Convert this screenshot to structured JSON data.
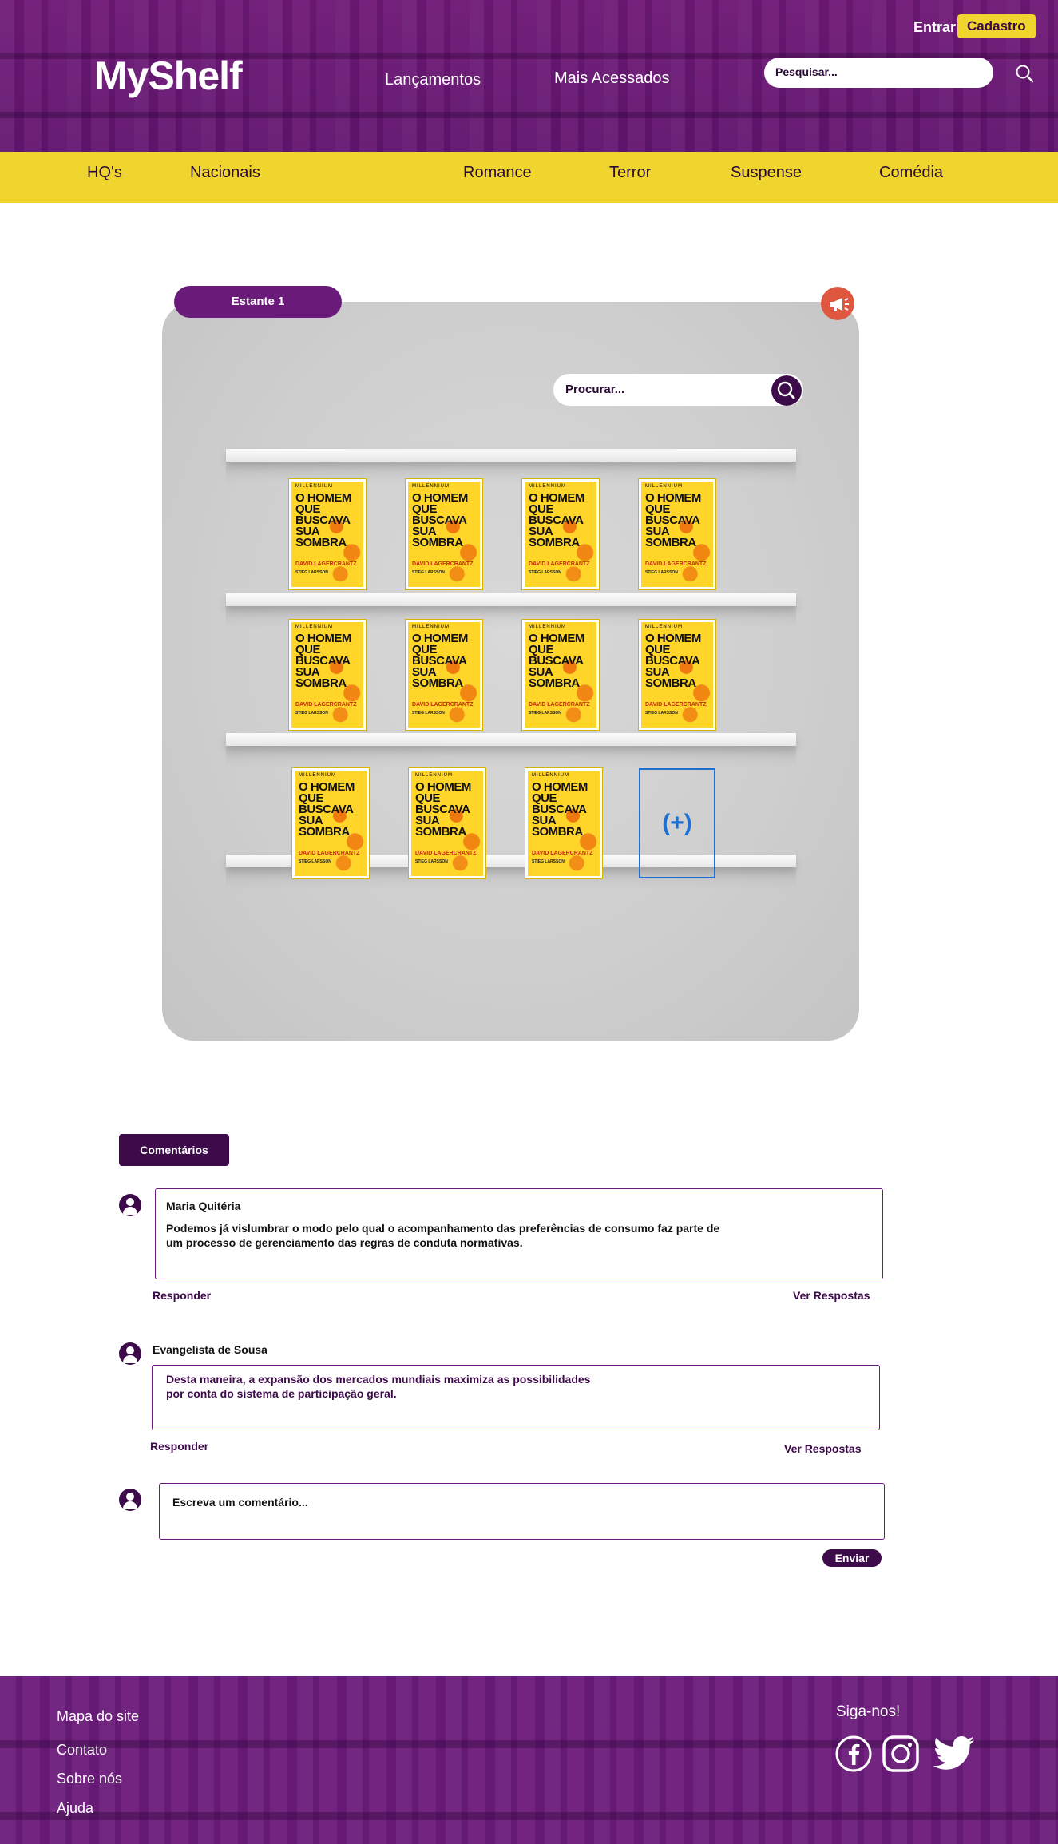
{
  "header": {
    "logo": "MyShelf",
    "nav": [
      "Lançamentos",
      "Mais Acessados"
    ],
    "login_label": "Entrar",
    "signup_label": "Cadastro",
    "search_placeholder": "Pesquisar..."
  },
  "categories": [
    "HQ's",
    "Nacionais",
    "Romance",
    "Terror",
    "Suspense",
    "Comédia"
  ],
  "shelf": {
    "tab_label": "Estante 1",
    "search_placeholder": "Procurar...",
    "book": {
      "series": "MILLENNIUM",
      "title": "O HOMEM QUE BUSCAVA SUA SOMBRA",
      "author": "DAVID LAGERCRANTZ",
      "subtitle": "STIEG LARSSON"
    },
    "book_count": 11,
    "add_label": "(+)"
  },
  "comments": {
    "tab_label": "Comentários",
    "items": [
      {
        "author": "Maria Quitéria",
        "text_line1": "Podemos já vislumbrar o modo pelo qual o acompanhamento das preferências de consumo faz parte de",
        "text_line2": "um processo de gerenciamento das regras de conduta normativas.",
        "reply_label": "Responder",
        "view_label": "Ver Respostas"
      },
      {
        "author": "Evangelista de Sousa",
        "text_line1": "Desta maneira, a expansão dos mercados mundiais maximiza as possibilidades",
        "text_line2": "por conta do sistema de participação geral.",
        "reply_label": "Responder",
        "view_label": "Ver Respostas"
      }
    ],
    "new_placeholder": "Escreva um comentário...",
    "send_label": "Enviar"
  },
  "footer": {
    "links": [
      "Mapa do site",
      "Contato",
      "Sobre nós",
      "Ajuda"
    ],
    "follow_label": "Siga-nos!",
    "social": [
      "facebook-icon",
      "instagram-icon",
      "twitter-icon"
    ]
  },
  "colors": {
    "primary": "#6a1b7a",
    "dark_primary": "#3d0a4a",
    "accent": "#f0d52e",
    "add_slot": "#1f6fd1",
    "alert": "#e0573f"
  }
}
